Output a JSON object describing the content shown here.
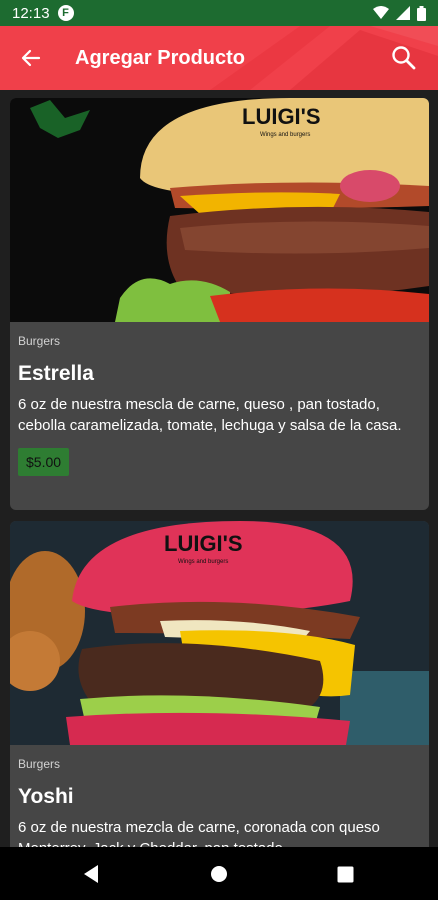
{
  "status_bar": {
    "time": "12:13",
    "app_icon_letter": "F",
    "icons": [
      "wifi-icon",
      "signal-icon",
      "battery-icon"
    ]
  },
  "app_bar": {
    "title": "Agregar Producto",
    "back_icon": "back-arrow-icon",
    "search_icon": "search-icon",
    "background_color": "#f0404a"
  },
  "products": [
    {
      "image_logo_text": "LUIGI'S",
      "image_logo_subtext": "Wings and burgers",
      "category": "Burgers",
      "name": "Estrella",
      "description": "6 oz de nuestra mescla de carne, queso , pan tostado, cebolla caramelizada, tomate, lechuga y salsa de la casa.",
      "price": "$5.00"
    },
    {
      "image_logo_text": "LUIGI'S",
      "image_logo_subtext": "Wings and burgers",
      "category": "Burgers",
      "name": "Yoshi",
      "description": "6 oz de  nuestra mezcla de carne,  coronada con queso Monterrey, Jack y Cheddar, pan tostado"
    }
  ],
  "nav_bar": {
    "icons": [
      "back-triangle-icon",
      "home-circle-icon",
      "recents-square-icon"
    ]
  },
  "colors": {
    "status_bar": "#1d6b30",
    "card_background": "#464646",
    "price_badge": "#2e7d32",
    "page_background": "#1f1f1f"
  }
}
